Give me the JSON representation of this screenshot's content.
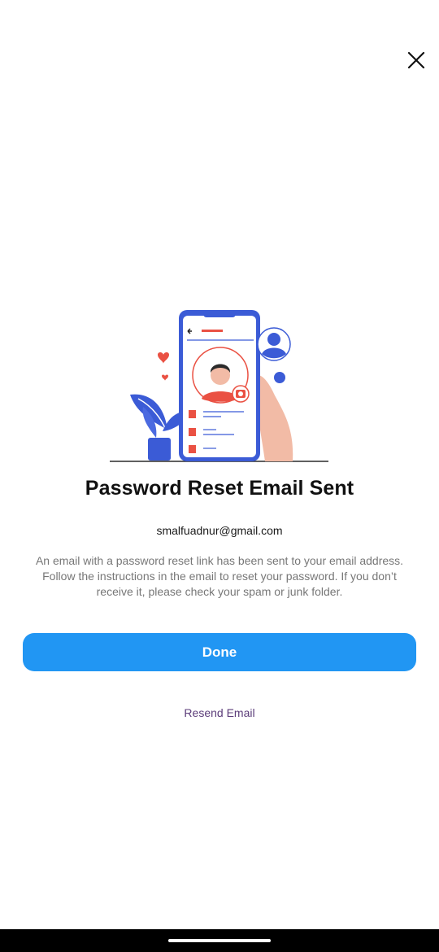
{
  "header": {
    "close_icon": "close-icon"
  },
  "illustration": {
    "name": "phone-profile-illustration"
  },
  "content": {
    "title": "Password Reset Email Sent",
    "email": "smalfuadnur@gmail.com",
    "description": "An email with a password reset link has been sent to your email address. Follow the instructions in the email to reset your password. If you don’t receive it, please check your spam or junk folder."
  },
  "actions": {
    "done_label": "Done",
    "resend_label": "Resend Email"
  },
  "colors": {
    "primary": "#2196f3",
    "link": "#5c3d7a",
    "title": "#111111",
    "body_text": "#777777"
  }
}
